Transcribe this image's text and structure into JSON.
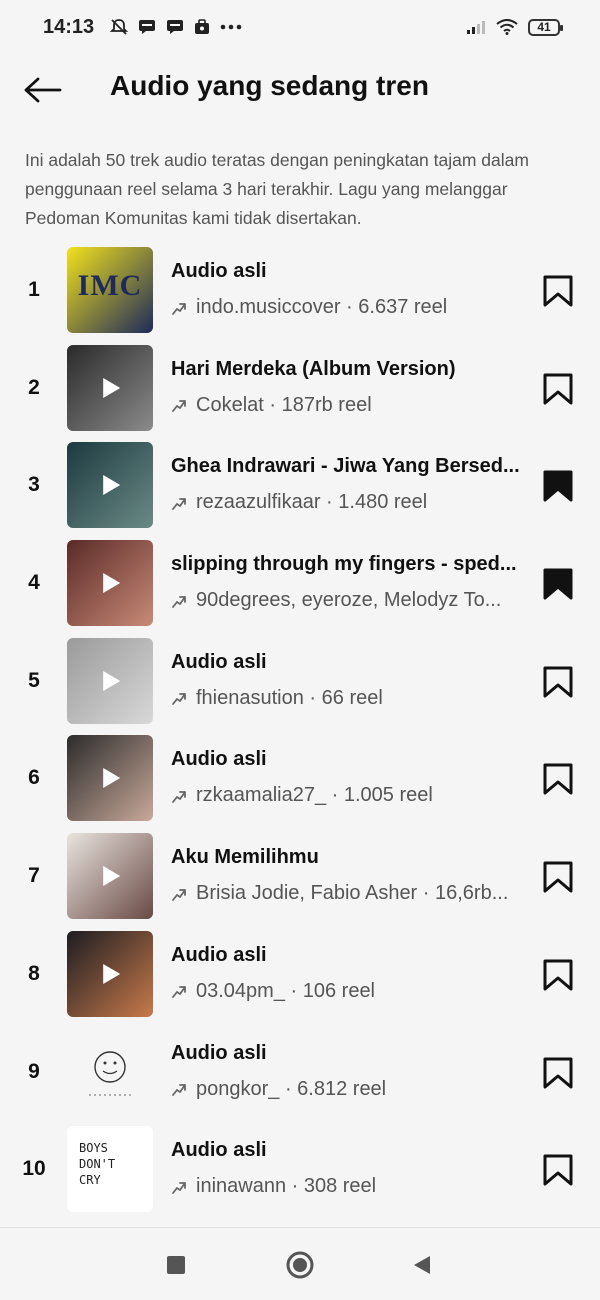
{
  "status": {
    "time": "14:13",
    "battery": "41",
    "icons": [
      "mute-bell-icon",
      "message-icon",
      "message-icon",
      "message-icon",
      "briefcase-icon",
      "more-dots-icon"
    ]
  },
  "header": {
    "title": "Audio yang sedang tren"
  },
  "description": "Ini adalah 50 trek audio teratas dengan peningkatan tajam dalam penggunaan reel selama 3 hari terakhir. Lagu yang melanggar Pedoman Komunitas kami tidak disertakan.",
  "tracks": [
    {
      "rank": "1",
      "title": "Audio asli",
      "meta": "indo.musiccover · 6.637 reel",
      "saved": false,
      "thumb_text": "IMC",
      "colors": [
        "#f2e11b",
        "#1e2a5a"
      ]
    },
    {
      "rank": "2",
      "title": "Hari Merdeka (Album Version)",
      "meta": "Cokelat · 187rb reel",
      "saved": false,
      "thumb_text": "",
      "colors": [
        "#2a2a2a",
        "#8b8b8b"
      ]
    },
    {
      "rank": "3",
      "title": "Ghea Indrawari - Jiwa Yang Bersed...",
      "meta": "rezaazulfikaar · 1.480 reel",
      "saved": true,
      "thumb_text": "",
      "colors": [
        "#1d3a3f",
        "#6a8a86"
      ]
    },
    {
      "rank": "4",
      "title": "slipping through my fingers - sped...",
      "meta": "90degrees, eyeroze, Melodyz To...",
      "saved": true,
      "thumb_text": "",
      "colors": [
        "#5a2a28",
        "#c98a77"
      ]
    },
    {
      "rank": "5",
      "title": "Audio asli",
      "meta": "fhienasution · 66 reel",
      "saved": false,
      "thumb_text": "",
      "colors": [
        "#9a9a9a",
        "#d8d8d8"
      ]
    },
    {
      "rank": "6",
      "title": "Audio asli",
      "meta": "rzkaamalia27_ · 1.005 reel",
      "saved": false,
      "thumb_text": "",
      "colors": [
        "#2b2b2b",
        "#c9a99a"
      ]
    },
    {
      "rank": "7",
      "title": "Aku Memilihmu",
      "meta": "Brisia Jodie, Fabio Asher · 16,6rb...",
      "saved": false,
      "thumb_text": "",
      "colors": [
        "#e9e4df",
        "#6a4a45"
      ]
    },
    {
      "rank": "8",
      "title": "Audio asli",
      "meta": "03.04pm_ · 106 reel",
      "saved": false,
      "thumb_text": "",
      "colors": [
        "#1c1c22",
        "#c87a4a"
      ]
    },
    {
      "rank": "9",
      "title": "Audio asli",
      "meta": "pongkor_ · 6.812 reel",
      "saved": false,
      "thumb_text": "",
      "colors": [
        "#f5f5f5",
        "#f5f5f5"
      ]
    },
    {
      "rank": "10",
      "title": "Audio asli",
      "meta": "ininawann · 308 reel",
      "saved": false,
      "thumb_text": "BOYS DON'T CRY",
      "colors": [
        "#ffffff",
        "#ffffff"
      ]
    }
  ]
}
